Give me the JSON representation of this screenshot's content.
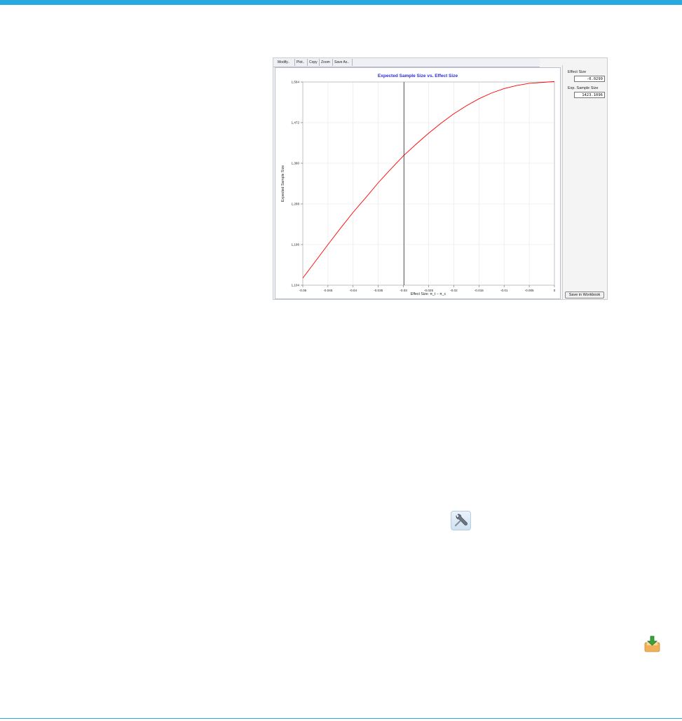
{
  "toolbar": {
    "modify": "Modify..",
    "plot": "Plot..",
    "copy": "Copy",
    "zoom": "Zoom",
    "save_as": "Save As.."
  },
  "side_panel": {
    "effect_size_label": "Effect Size",
    "effect_size_value": "-0.0299",
    "exp_sample_size_label": "Exp. Sample Size",
    "exp_sample_size_value": "1423.1096",
    "save_button": "Save in Workbook"
  },
  "icons": {
    "wrench": "wrench-icon",
    "import": "import-icon"
  },
  "colors": {
    "accent": "#2aa8e0",
    "title": "#2b2bd6",
    "curve": "#ff0000"
  },
  "chart_data": {
    "type": "line",
    "title": "Expected Sample Size vs. Effect Size",
    "xlabel": "Effect Size: π_t − π_c",
    "ylabel": "Expected Sample Size",
    "xlim": [
      -0.05,
      0
    ],
    "ylim": [
      1104,
      1564
    ],
    "x_ticks": [
      -0.05,
      -0.045,
      -0.04,
      -0.035,
      -0.03,
      -0.025,
      -0.02,
      -0.015,
      -0.01,
      -0.005,
      0
    ],
    "x_tick_labels": [
      "-0.05",
      "-0.045",
      "-0.04",
      "-0.035",
      "-0.03",
      "-0.025",
      "-0.02",
      "-0.015",
      "-0.01",
      "-0.005",
      "0"
    ],
    "y_ticks": [
      1104,
      1196,
      1288,
      1380,
      1472,
      1564
    ],
    "y_tick_labels": [
      "1,104",
      "1,196",
      "1,288",
      "1,380",
      "1,472",
      "1,564"
    ],
    "grid": true,
    "marker_line_x": -0.0299,
    "series": [
      {
        "x": [
          -0.05,
          -0.0475,
          -0.045,
          -0.0425,
          -0.04,
          -0.0375,
          -0.035,
          -0.0325,
          -0.03,
          -0.0275,
          -0.025,
          -0.0225,
          -0.02,
          -0.0175,
          -0.015,
          -0.0125,
          -0.01,
          -0.0075,
          -0.005,
          -0.0025,
          0
        ],
        "y": [
          1120,
          1158,
          1196,
          1233,
          1269,
          1302,
          1336,
          1367,
          1397,
          1423,
          1448,
          1471,
          1492,
          1510,
          1526,
          1539,
          1549,
          1556,
          1561,
          1563,
          1565
        ]
      }
    ]
  }
}
